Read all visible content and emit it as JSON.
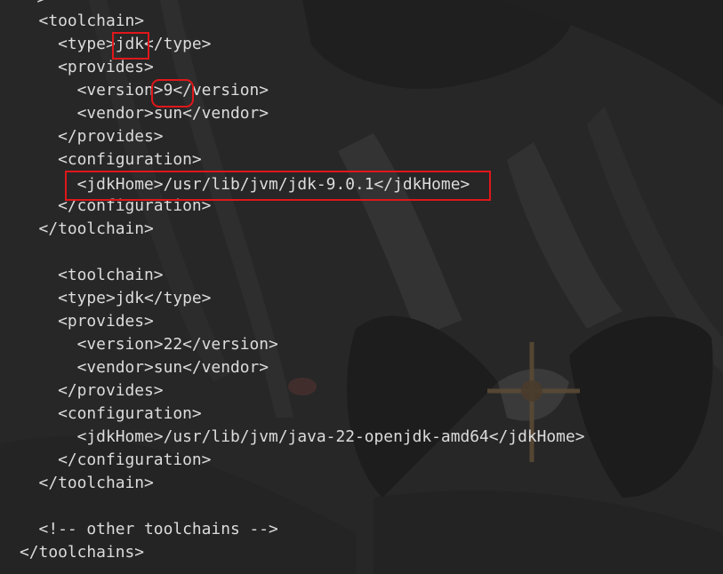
{
  "editor": {
    "lines": [
      "-->",
      "  <toolchain>",
      "    <type>jdk</type>",
      "    <provides>",
      "      <version>9</version>",
      "      <vendor>sun</vendor>",
      "    </provides>",
      "    <configuration>",
      "      <jdkHome>/usr/lib/jvm/jdk-9.0.1</jdkHome>",
      "    </configuration>",
      "  </toolchain>",
      "",
      "    <toolchain>",
      "    <type>jdk</type>",
      "    <provides>",
      "      <version>22</version>",
      "      <vendor>sun</vendor>",
      "    </provides>",
      "    <configuration>",
      "      <jdkHome>/usr/lib/jvm/java-22-openjdk-amd64</jdkHome>",
      "    </configuration>",
      "  </toolchain>",
      "",
      "  <!-- other toolchains -->",
      "</toolchains>"
    ],
    "highlight_color": "#e0171a",
    "text_color": "#dcdcdc",
    "background_color": "#282828"
  }
}
